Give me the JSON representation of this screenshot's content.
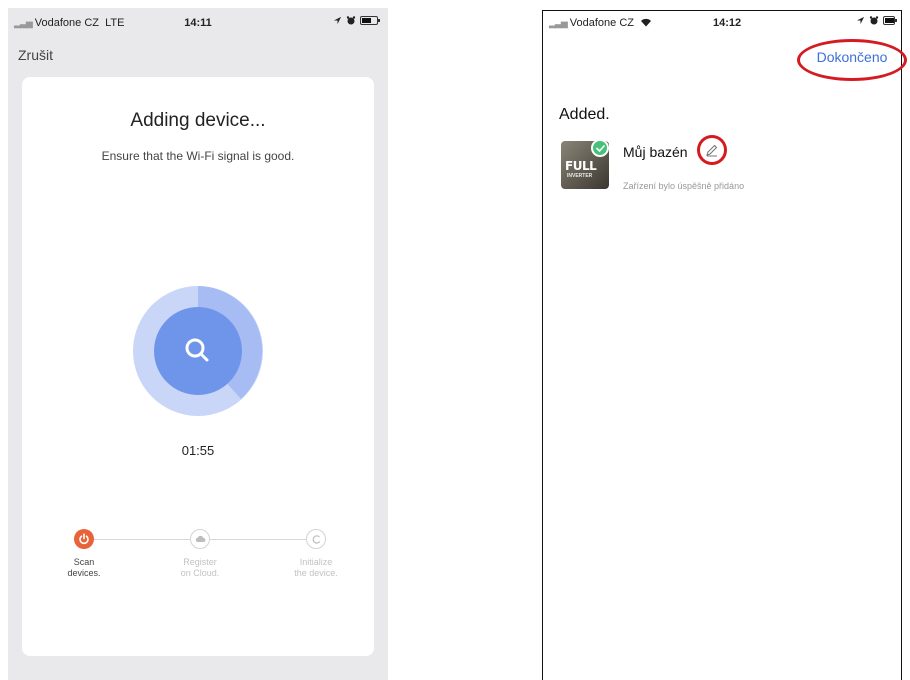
{
  "left": {
    "status": {
      "carrier": "Vodafone CZ",
      "network": "LTE",
      "time": "14:11"
    },
    "cancel_label": "Zrušit",
    "title": "Adding device...",
    "subtitle": "Ensure that the Wi-Fi signal is good.",
    "countdown": "01:55",
    "steps": [
      {
        "label_line1": "Scan",
        "label_line2": "devices.",
        "state": "active",
        "icon": "power-icon"
      },
      {
        "label_line1": "Register",
        "label_line2": "on Cloud.",
        "state": "inactive",
        "icon": "cloud-icon"
      },
      {
        "label_line1": "Initialize",
        "label_line2": "the device.",
        "state": "inactive",
        "icon": "refresh-icon"
      }
    ],
    "colors": {
      "accent": "#e8633a",
      "radar_outer": "#c9d6f7",
      "radar_mid": "#a7bcf3",
      "radar_inner": "#6f95ea"
    }
  },
  "right": {
    "status": {
      "carrier": "Vodafone CZ",
      "time": "14:12"
    },
    "done_label": "Dokončeno",
    "added_label": "Added.",
    "device": {
      "name": "Můj bazén",
      "status_text": "Zařízení bylo úspěšně přidáno",
      "thumb_brand": "FULL",
      "thumb_sub": "INVERTER"
    },
    "colors": {
      "link": "#3d6fd8",
      "annotation": "#d51b22",
      "success": "#47c07a"
    }
  }
}
